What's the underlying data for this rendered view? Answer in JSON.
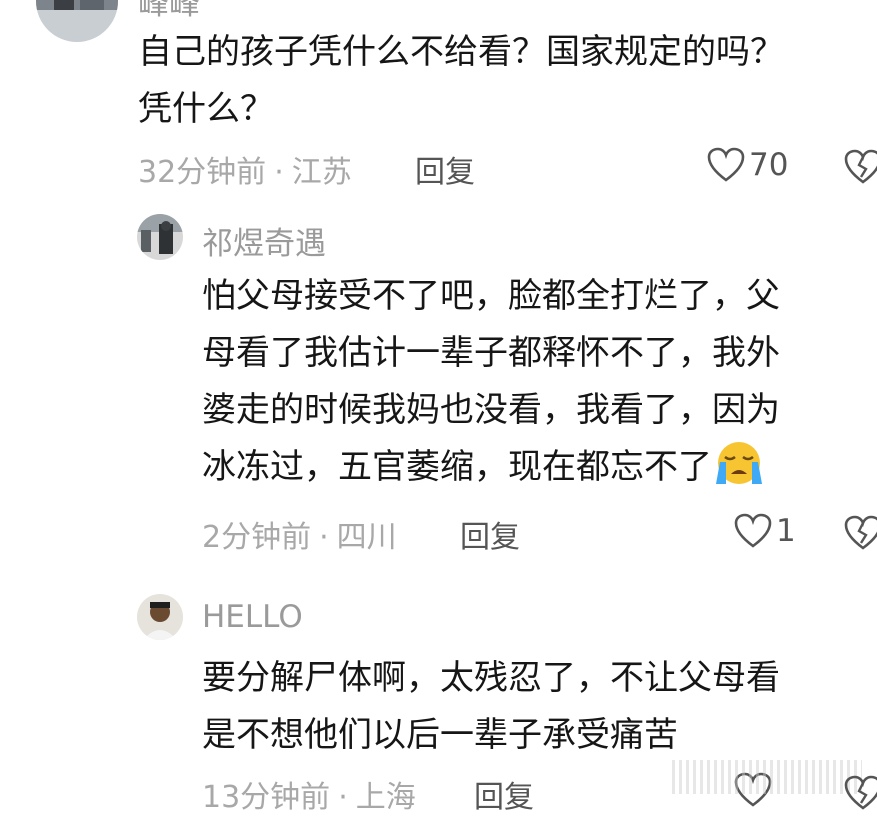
{
  "comments": [
    {
      "author": "峰峰",
      "lines": [
        "自己的孩子凭什么不给看？国家规定的吗？",
        "凭什么？"
      ],
      "time": "32分钟前",
      "location": "江苏",
      "reply_label": "回复",
      "likes": "70"
    },
    {
      "author": "祁煜奇遇",
      "lines": [
        "怕父母接受不了吧，脸都全打烂了，父",
        "母看了我估计一辈子都释怀不了，我外",
        "婆走的时候我妈也没看，我看了，因为",
        "冰冻过，五官萎缩，现在都忘不了"
      ],
      "emoji": "crying-face",
      "time": "2分钟前",
      "location": "四川",
      "reply_label": "回复",
      "likes": "1"
    },
    {
      "author": "HELLO",
      "lines": [
        "要分解尸体啊，太残忍了，不让父母看",
        "是不想他们以后一辈子承受痛苦"
      ],
      "time": "13分钟前",
      "location": "上海",
      "reply_label": "回复"
    }
  ],
  "separator": "·",
  "icons": {
    "like": "heart-outline-icon",
    "dislike": "broken-heart-icon"
  },
  "colors": {
    "meta": "#a8a8a8",
    "text": "#161616",
    "emoji_yellow": "#f7c531",
    "tear_blue": "#3fa9f5"
  }
}
